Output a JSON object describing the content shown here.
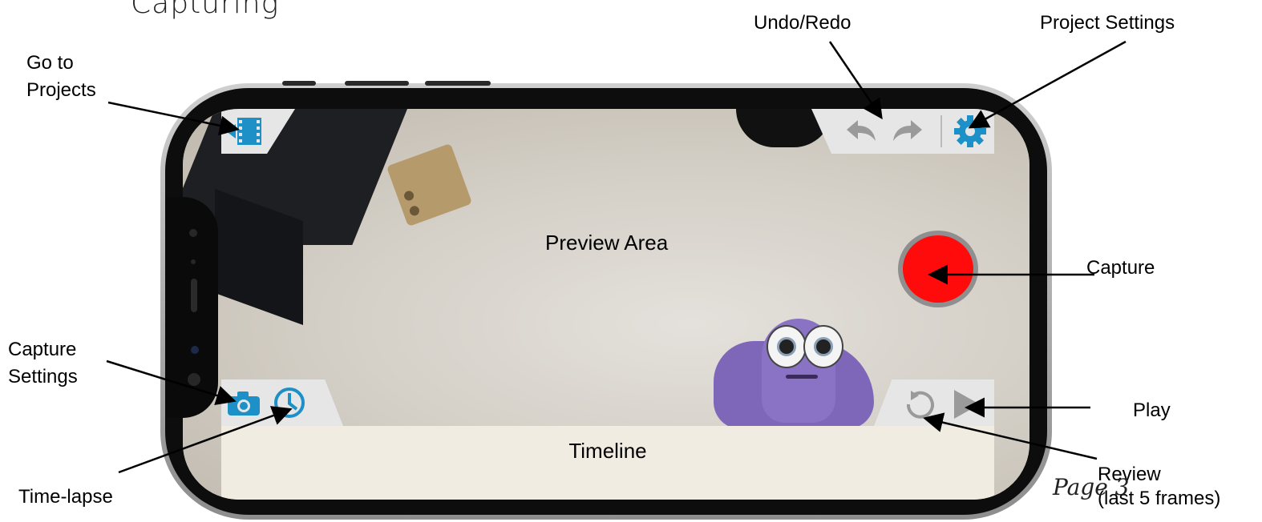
{
  "heading": "Capturing",
  "callouts": {
    "go_to_projects": "Go to\nProjects",
    "undo_redo": "Undo/Redo",
    "project_settings": "Project Settings",
    "capture": "Capture",
    "capture_settings": "Capture\nSettings",
    "play": "Play",
    "time_lapse": "Time-lapse",
    "review": "Review\n(last 5 frames)"
  },
  "screen": {
    "preview_label": "Preview Area",
    "timeline_label": "Timeline"
  },
  "page_label": "Page 3",
  "icons": [
    "projects-film-icon",
    "undo-icon",
    "redo-icon",
    "gear-icon",
    "camera-icon",
    "clock-icon",
    "review-icon",
    "play-icon"
  ],
  "colors": {
    "accent_blue": "#1d91c7",
    "capture_red": "#ff0b0b",
    "panel_gray": "#e6e6e6",
    "icon_gray": "#9a9a9a"
  }
}
